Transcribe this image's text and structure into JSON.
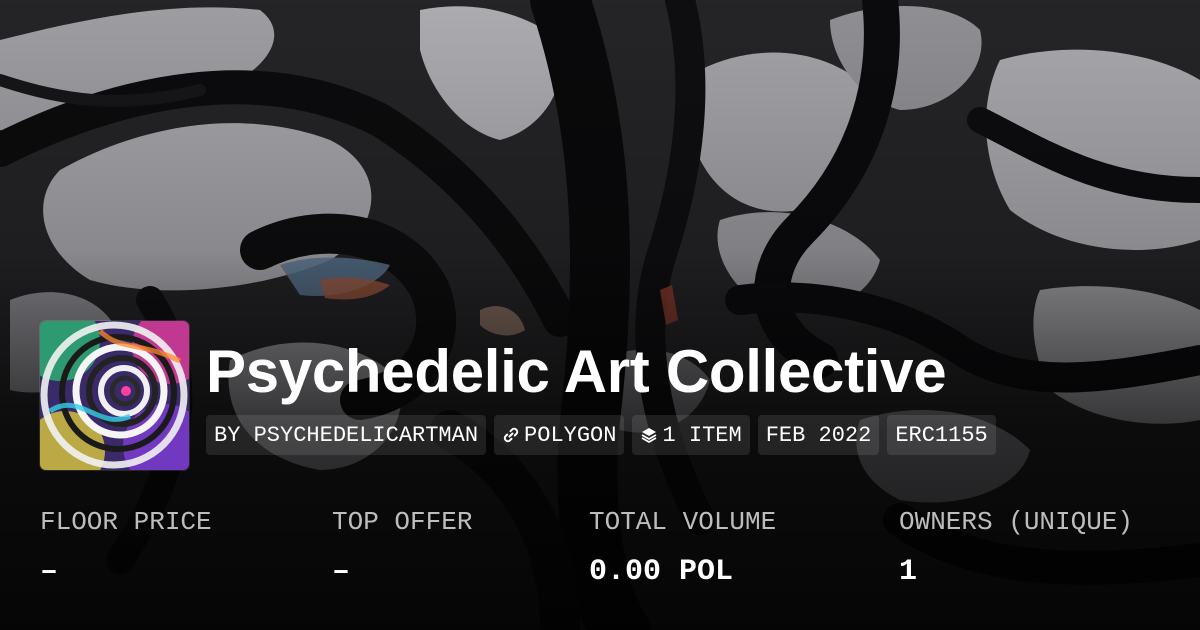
{
  "collection": {
    "title": "Psychedelic Art Collective",
    "banner_image": "abstract-black-and-white-painting",
    "logo_image": "psychedelic-spiral-artwork"
  },
  "chips": [
    {
      "label": "BY PSYCHEDELICARTMAN"
    },
    {
      "icon": "link-icon",
      "label": "POLYGON"
    },
    {
      "icon": "stack-icon",
      "label": "1 ITEM"
    },
    {
      "label": "FEB 2022"
    },
    {
      "label": "ERC1155"
    }
  ],
  "stats": [
    {
      "label": "FLOOR PRICE",
      "value": "–"
    },
    {
      "label": "TOP OFFER",
      "value": "–"
    },
    {
      "label": "TOTAL VOLUME",
      "value": "0.00 POL"
    },
    {
      "label": "OWNERS (UNIQUE)",
      "value": "1"
    }
  ],
  "colors": {
    "text": "#ffffff",
    "label": "#bdbdbd",
    "chip_bg": "rgba(255,255,255,0.10)"
  }
}
